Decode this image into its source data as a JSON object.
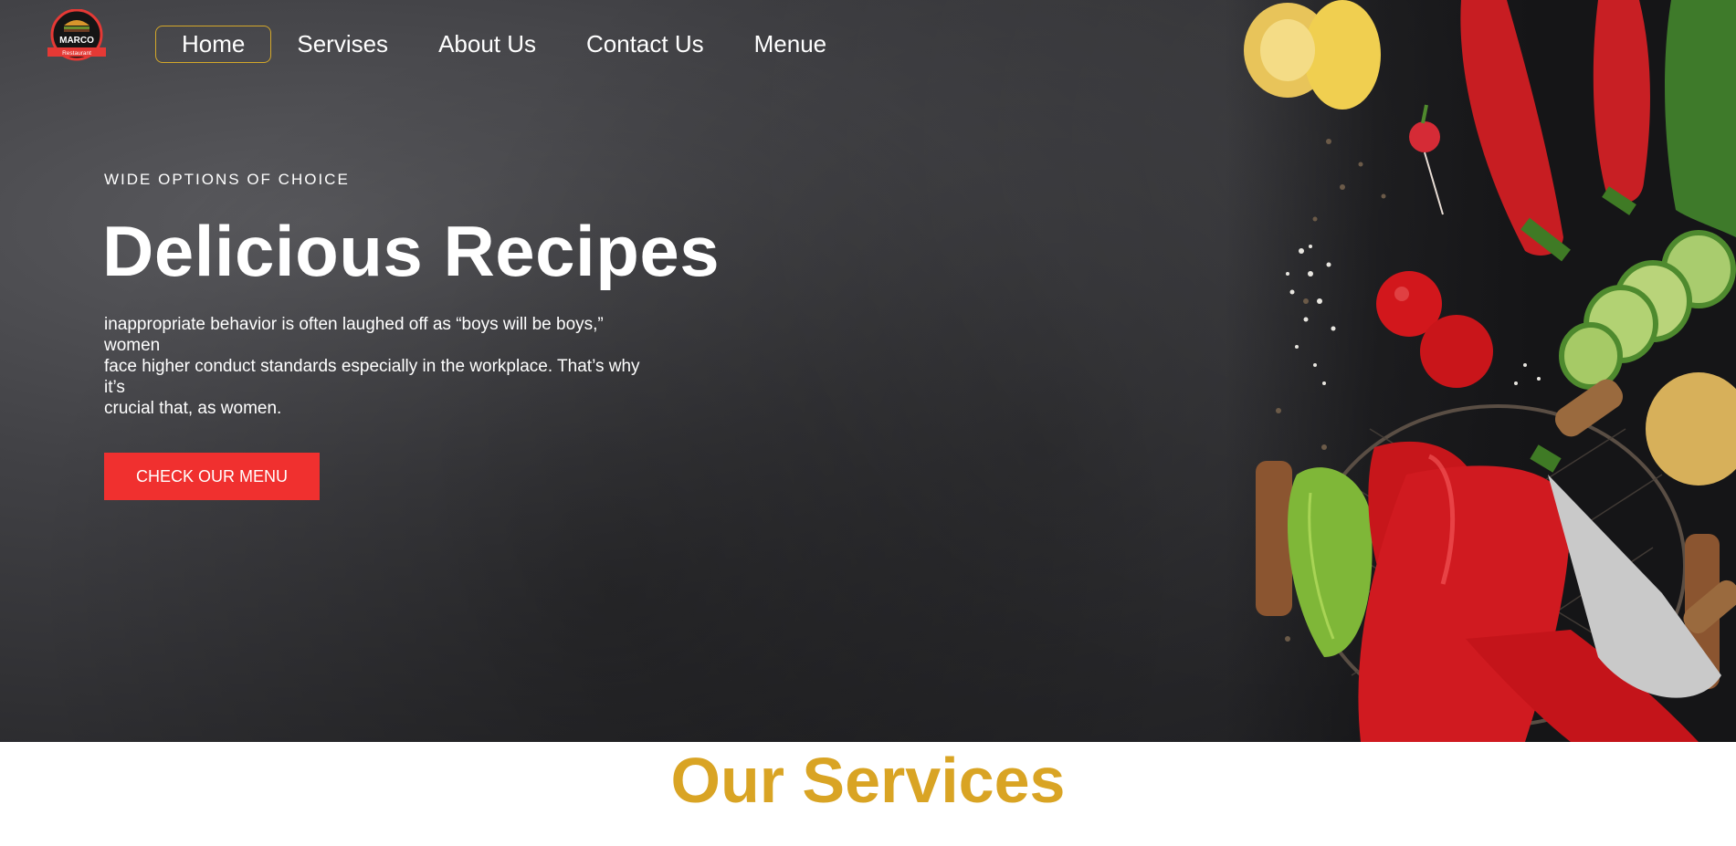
{
  "brand": {
    "logo_name": "MARCO",
    "logo_sub": "Restaurant",
    "accent_color": "#d4a82a",
    "cta_color": "#f0302f",
    "services_color": "#d9a424"
  },
  "nav": {
    "items": [
      {
        "label": "Home",
        "active": true
      },
      {
        "label": "Servises",
        "active": false
      },
      {
        "label": "About Us",
        "active": false
      },
      {
        "label": "Contact Us",
        "active": false
      },
      {
        "label": "Menue",
        "active": false
      }
    ]
  },
  "hero": {
    "eyebrow": "WIDE OPTIONS OF CHOICE",
    "title": "Delicious Recipes",
    "body_lines": [
      "inappropriate behavior is often laughed off as “boys will be boys,”",
      "women",
      "face higher conduct standards especially in the workplace. That’s why",
      "it’s",
      "crucial that, as women."
    ],
    "cta_label": "CHECK OUR MENU"
  },
  "services": {
    "title": "Our Services"
  }
}
